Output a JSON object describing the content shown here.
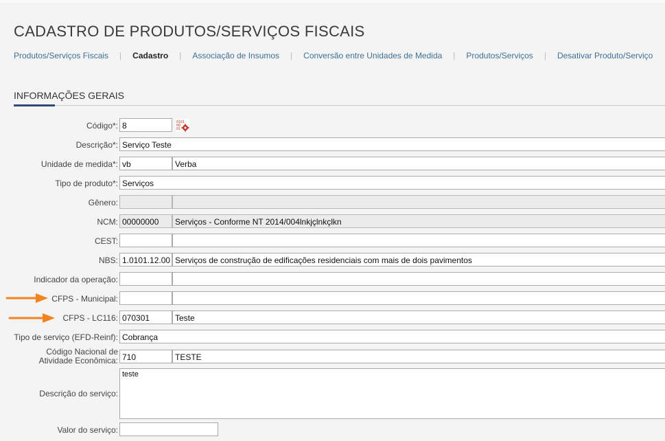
{
  "page": {
    "title": "CADASTRO DE PRODUTOS/SERVIÇOS FISCAIS",
    "section_title": "INFORMAÇÕES GERAIS",
    "accent_color": "#2f4a78",
    "annotation_color": "#f58220"
  },
  "breadcrumb": [
    {
      "label": "Produtos/Serviços Fiscais"
    },
    {
      "label": "Cadastro"
    },
    {
      "label": "Associação de Insumos"
    },
    {
      "label": "Conversão entre Unidades de Medida"
    },
    {
      "label": "Produtos/Serviços"
    },
    {
      "label": "Desativar Produto/Serviço"
    }
  ],
  "form": {
    "codigo": {
      "label": "Código*:",
      "value": "8",
      "icon": "barcode-gear-icon"
    },
    "descricao": {
      "label": "Descrição*:",
      "value": "Serviço Teste"
    },
    "unidade": {
      "label": "Unidade de medida*:",
      "code": "vb",
      "desc": "Verba"
    },
    "tipo_produto": {
      "label": "Tipo de produto*:",
      "value": "Serviços"
    },
    "genero": {
      "label": "Gênero:",
      "code": "",
      "desc": ""
    },
    "ncm": {
      "label": "NCM:",
      "code": "00000000",
      "desc": "Serviços - Conforme NT 2014/004lnkjçlnkçlkn"
    },
    "cest": {
      "label": "CEST:",
      "code": "",
      "desc": ""
    },
    "nbs": {
      "label": "NBS:",
      "code": "1.0101.12.00",
      "desc": "Serviços de construção de edificações residenciais com mais de dois pavimentos"
    },
    "indicador": {
      "label": "Indicador da operação:",
      "code": "",
      "desc": ""
    },
    "cfps_municipal": {
      "label": "CFPS - Municipal:",
      "code": "",
      "desc": ""
    },
    "cfps_lc116": {
      "label": "CFPS - LC116:",
      "code": "070301",
      "desc": "Teste"
    },
    "tipo_servico": {
      "label": "Tipo de serviço (EFD-Reinf):",
      "value": "Cobrança"
    },
    "cnae": {
      "label_line1": "Código Nacional de",
      "label_line2": "Atividade Econômica:",
      "code": "710",
      "desc": "TESTE"
    },
    "descricao_servico": {
      "label": "Descrição do serviço:",
      "value": "teste"
    },
    "valor_servico": {
      "label": "Valor do serviço:",
      "value": ""
    }
  }
}
